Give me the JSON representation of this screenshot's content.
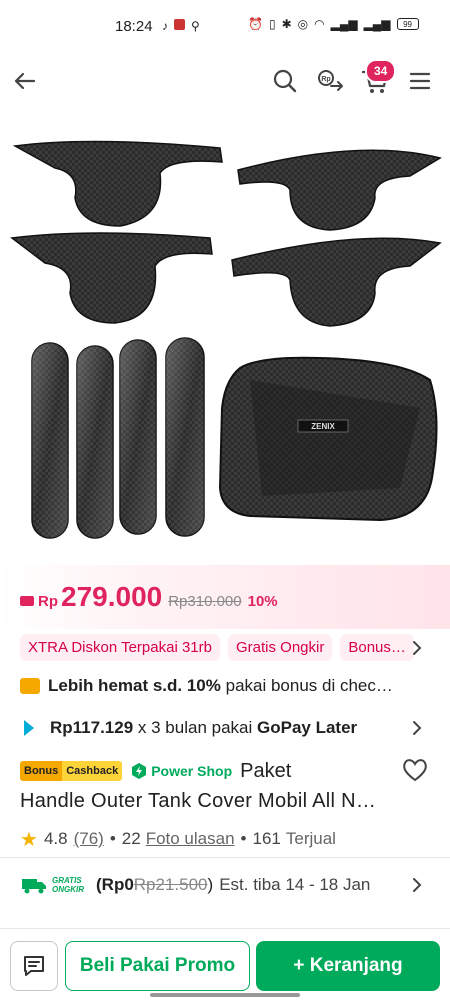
{
  "status_bar": {
    "time": "18:24",
    "battery": "99"
  },
  "header": {
    "cart_count": "34",
    "icons": [
      "back-arrow-icon",
      "search-icon",
      "share-icon",
      "cart-icon",
      "menu-icon"
    ]
  },
  "price": {
    "currency_prefix": "Rp",
    "current": "279.000",
    "original": "Rp310.000",
    "discount": "10%"
  },
  "chips": [
    "XTRA Diskon Terpakai 31rb",
    "Gratis Ongkir",
    "Bonus…"
  ],
  "bonus_row": {
    "bold_text": "Lebih hemat s.d. 10%",
    "rest_text": " pakai bonus di chec…"
  },
  "gopay_row": {
    "amount": "Rp117.129",
    "mid_text": " x 3 bulan pakai ",
    "brand": "GoPay Later"
  },
  "title_row": {
    "badge_bonus": "Bonus",
    "badge_cashback": "Cashback",
    "power_shop": "Power Shop",
    "title_start": "Paket",
    "title_line2": "Handle Outer Tank Cover Mobil All N…"
  },
  "rating_row": {
    "rating": "4.8",
    "rating_count": "(76)",
    "photo_count": "22",
    "photo_label": "Foto ulasan",
    "sold_count": "161",
    "sold_label": "Terjual",
    "bullet": "•"
  },
  "shipping_row": {
    "gratis_ongkir_label": "GRATIS ONGKIR",
    "cost": "(Rp0",
    "old_cost": "Rp21.500",
    "close_paren": ")",
    "eta": "Est. tiba 14 - 18 Jan"
  },
  "bottom_bar": {
    "promo_button": "Beli Pakai Promo",
    "cart_button": "+ Keranjang"
  },
  "colors": {
    "brand_green": "#00aa5b",
    "price_pink": "#e0245e",
    "chip_text": "#d6004c"
  }
}
